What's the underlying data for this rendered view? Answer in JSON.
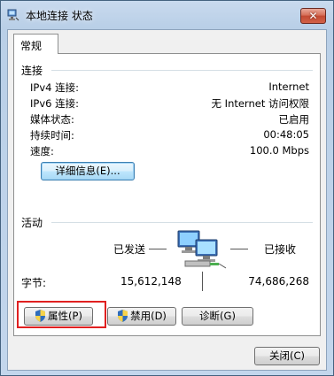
{
  "window": {
    "title": "本地连接 状态",
    "close_symbol": "✕"
  },
  "tabs": [
    {
      "label": "常规"
    }
  ],
  "connection": {
    "group_label": "连接",
    "rows": [
      {
        "label": "IPv4 连接:",
        "value": "Internet"
      },
      {
        "label": "IPv6 连接:",
        "value": "无 Internet 访问权限"
      },
      {
        "label": "媒体状态:",
        "value": "已启用"
      },
      {
        "label": "持续时间:",
        "value": "00:48:05"
      },
      {
        "label": "速度:",
        "value": "100.0 Mbps"
      }
    ],
    "details_button": "详细信息(E)..."
  },
  "activity": {
    "group_label": "活动",
    "sent_label": "已发送",
    "received_label": "已接收",
    "bytes_label": "字节:",
    "bytes_sent": "15,612,148",
    "bytes_received": "74,686,268"
  },
  "buttons": {
    "properties": "属性(P)",
    "disable": "禁用(D)",
    "diagnose": "诊断(G)",
    "close": "关闭(C)"
  },
  "icons": {
    "title": "network-connection-icon",
    "activity": "network-computers-icon",
    "shield": "uac-shield-icon"
  },
  "colors": {
    "highlight": "#e02020",
    "close_button": "#c24a32"
  }
}
